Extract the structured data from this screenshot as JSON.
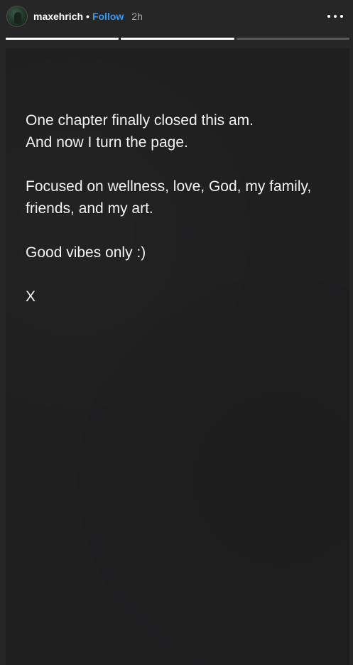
{
  "header": {
    "username": "maxehrich",
    "separator": "•",
    "follow_label": "Follow",
    "time": "2h"
  },
  "icons": {
    "avatar": "profile-avatar",
    "more": "more-options-icon"
  },
  "progress": {
    "segments": [
      {
        "filled": 1.0
      },
      {
        "filled": 1.0
      },
      {
        "filled": 0.0
      }
    ]
  },
  "story": {
    "paragraphs": [
      [
        "One chapter finally closed this am.",
        "And now I turn the page."
      ],
      [
        "Focused on wellness, love, God, my family,",
        "friends, and my art."
      ],
      [
        "Good vibes only :)"
      ],
      [
        "X"
      ]
    ]
  },
  "colors": {
    "follow": "#3897f0",
    "background": "#262626",
    "story_bg": "#1f1f20",
    "text": "#f2f2f2"
  }
}
